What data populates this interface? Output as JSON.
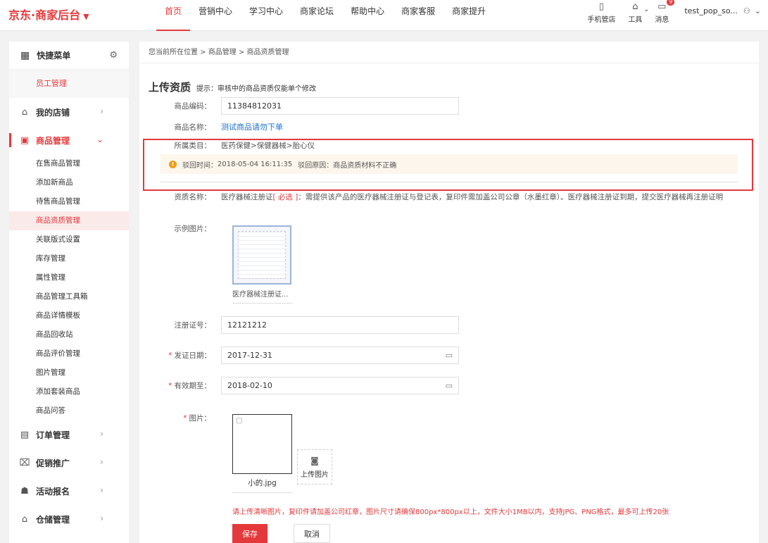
{
  "header": {
    "logo": "京东·商家后台",
    "logo_caret": "▼",
    "nav": [
      "首页",
      "营销中心",
      "学习中心",
      "商家论坛",
      "帮助中心",
      "商家客服",
      "商家提升"
    ],
    "tools": {
      "mobile": "手机管店",
      "tools": "工具",
      "messages": "消息",
      "message_badge": "9"
    },
    "username": "test_pop_so..."
  },
  "sidebar": {
    "quick_menu": "快捷菜单",
    "quick_item": "员工管理",
    "my_shop": "我的店铺",
    "goods_mgmt": "商品管理",
    "goods_items": [
      "在售商品管理",
      "添加新商品",
      "待售商品管理",
      "商品资质管理",
      "关联版式设置",
      "库存管理",
      "属性管理",
      "商品管理工具箱",
      "商品详情模板",
      "商品回收站",
      "商品评价管理",
      "图片管理",
      "添加套装商品",
      "商品问答"
    ],
    "order_mgmt": "订单管理",
    "promotion": "促销推广",
    "activity": "活动报名",
    "warehouse": "仓储管理"
  },
  "breadcrumb": "您当前所在位置 > 商品管理 > 商品资质管理",
  "page": {
    "title": "上传资质",
    "tip": "提示：审核中的商品资质仅能单个修改"
  },
  "form": {
    "code_label": "商品编码：",
    "code_value": "11384812031",
    "name_label": "商品名称：",
    "name_value": "测试商品请勿下单",
    "category_label": "所属类目：",
    "category_value": "医药保健>保健器械>胎心仪",
    "reject_time_label": "驳回时间：",
    "reject_time": "2018-05-04 16:11:35",
    "reject_reason_label": "驳回原因：",
    "reject_reason": "商品资质材料不正确",
    "qual_label": "资质名称：",
    "qual_name": "医疗器械注册证",
    "qual_required": "[ 必选 ]",
    "qual_desc": "：需提供该产品的医疗器械注册证与登记表，复印件需加盖公司公章（水墨红章）。医疗器械注册证到期，提交医疗器械再注册证明",
    "sample_label": "示例图片：",
    "sample_caption": "医疗器械注册证...",
    "reg_label": "注册证号：",
    "reg_value": "12121212",
    "issue_label": "发证日期：",
    "issue_value": "2017-12-31",
    "expire_label": "有效期至：",
    "expire_value": "2018-02-10",
    "image_label": "图片：",
    "image_caption": "小的.jpg",
    "upload_label": "上传图片",
    "hint": "请上传清晰图片，复印件请加盖公司红章，图片尺寸请确保800px*800px以上，文件大小1MB以内，支持JPG、PNG格式，最多可上传20张",
    "save": "保存",
    "cancel": "取消"
  },
  "colors": {
    "accent": "#e4393c",
    "link": "#1a6fd4",
    "warning_bg": "#fdf6ec",
    "warning_icon": "#f39c12"
  }
}
